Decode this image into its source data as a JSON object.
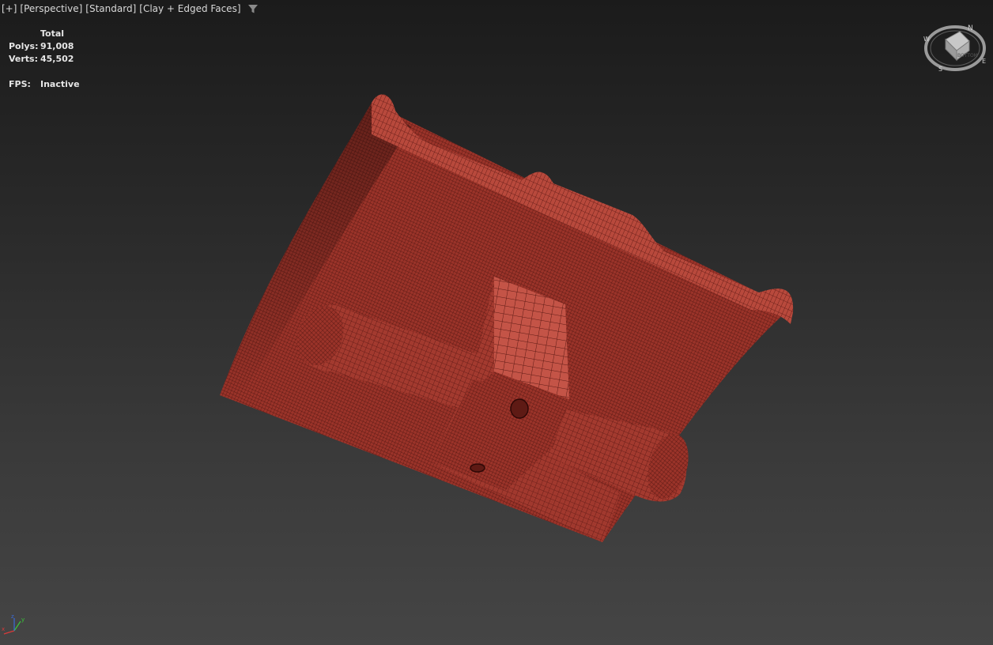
{
  "viewport": {
    "menus": [
      "[+]",
      "[Perspective]",
      "[Standard]",
      "[Clay + Edged Faces]"
    ],
    "filter_icon": "viewport-filter-icon"
  },
  "stats": {
    "header": "Total",
    "polys_label": "Polys:",
    "polys_value": "91,008",
    "verts_label": "Verts:",
    "verts_value": "45,502",
    "fps_label": "FPS:",
    "fps_value": "Inactive"
  },
  "viewcube": {
    "face_label": "BOTTOM",
    "compass": [
      "N",
      "E",
      "S",
      "W"
    ]
  },
  "axis": {
    "x": "x",
    "y": "y",
    "z": "z"
  },
  "colors": {
    "model_base": "#a63a2e",
    "model_dark": "#5a1410",
    "model_light": "#c8574a",
    "background_top": "#1b1b1b",
    "background_bottom": "#454545"
  }
}
